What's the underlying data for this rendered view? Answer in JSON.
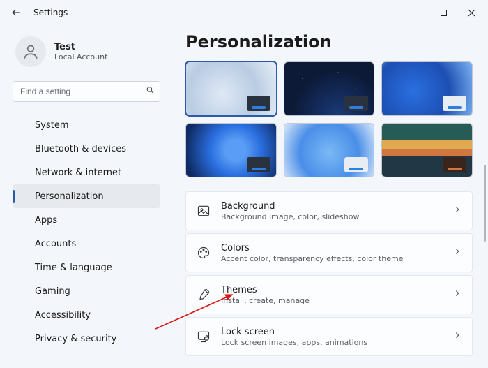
{
  "app": {
    "title": "Settings"
  },
  "user": {
    "name": "Test",
    "sub": "Local Account"
  },
  "search": {
    "placeholder": "Find a setting"
  },
  "nav": {
    "items": [
      {
        "label": "System"
      },
      {
        "label": "Bluetooth & devices"
      },
      {
        "label": "Network & internet"
      },
      {
        "label": "Personalization"
      },
      {
        "label": "Apps"
      },
      {
        "label": "Accounts"
      },
      {
        "label": "Time & language"
      },
      {
        "label": "Gaming"
      },
      {
        "label": "Accessibility"
      },
      {
        "label": "Privacy & security"
      }
    ],
    "selected_index": 3
  },
  "page": {
    "title": "Personalization"
  },
  "cards": [
    {
      "title": "Background",
      "sub": "Background image, color, slideshow"
    },
    {
      "title": "Colors",
      "sub": "Accent color, transparency effects, color theme"
    },
    {
      "title": "Themes",
      "sub": "Install, create, manage"
    },
    {
      "title": "Lock screen",
      "sub": "Lock screen images, apps, animations"
    }
  ]
}
